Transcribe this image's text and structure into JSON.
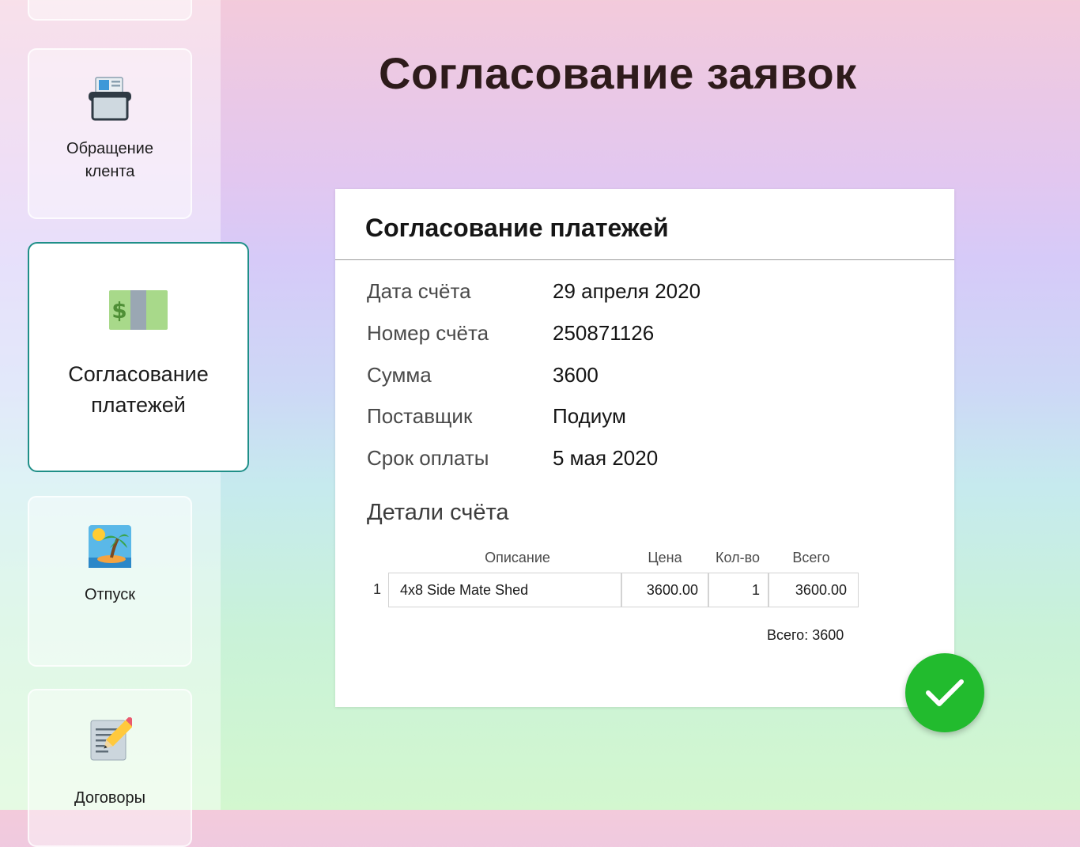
{
  "sidebar": {
    "items": [
      {
        "label": "",
        "icon": "blank-card"
      },
      {
        "label": "Обращение клента",
        "icon": "customer-appeal-icon"
      },
      {
        "label": "Согласование платежей",
        "icon": "money-icon",
        "active": true
      },
      {
        "label": "Отпуск",
        "icon": "vacation-island-icon"
      },
      {
        "label": "Договоры",
        "icon": "memo-pencil-icon"
      }
    ]
  },
  "page": {
    "title": "Согласование заявок"
  },
  "panel": {
    "title": "Согласование платежей",
    "fields": [
      {
        "label": "Дата счёта",
        "value": "29 апреля 2020"
      },
      {
        "label": "Номер счёта",
        "value": "250871126"
      },
      {
        "label": "Сумма",
        "value": "3600"
      },
      {
        "label": "Поставщик",
        "value": "Подиум"
      },
      {
        "label": "Срок оплаты",
        "value": "5 мая 2020"
      }
    ],
    "details_title": "Детали счёта",
    "table": {
      "headers": [
        "Описание",
        "Цена",
        "Кол-во",
        "Всего"
      ],
      "rows": [
        {
          "num": "1",
          "description": "4x8 Side Mate Shed",
          "price": "3600.00",
          "qty": "1",
          "total": "3600.00"
        }
      ]
    },
    "grand_total": "Всего: 3600"
  },
  "colors": {
    "accent_border": "#1f8f88",
    "approve_button": "#22bb2e",
    "title_text": "#2e1b1b"
  },
  "approve_button": {
    "icon": "checkmark-icon"
  }
}
